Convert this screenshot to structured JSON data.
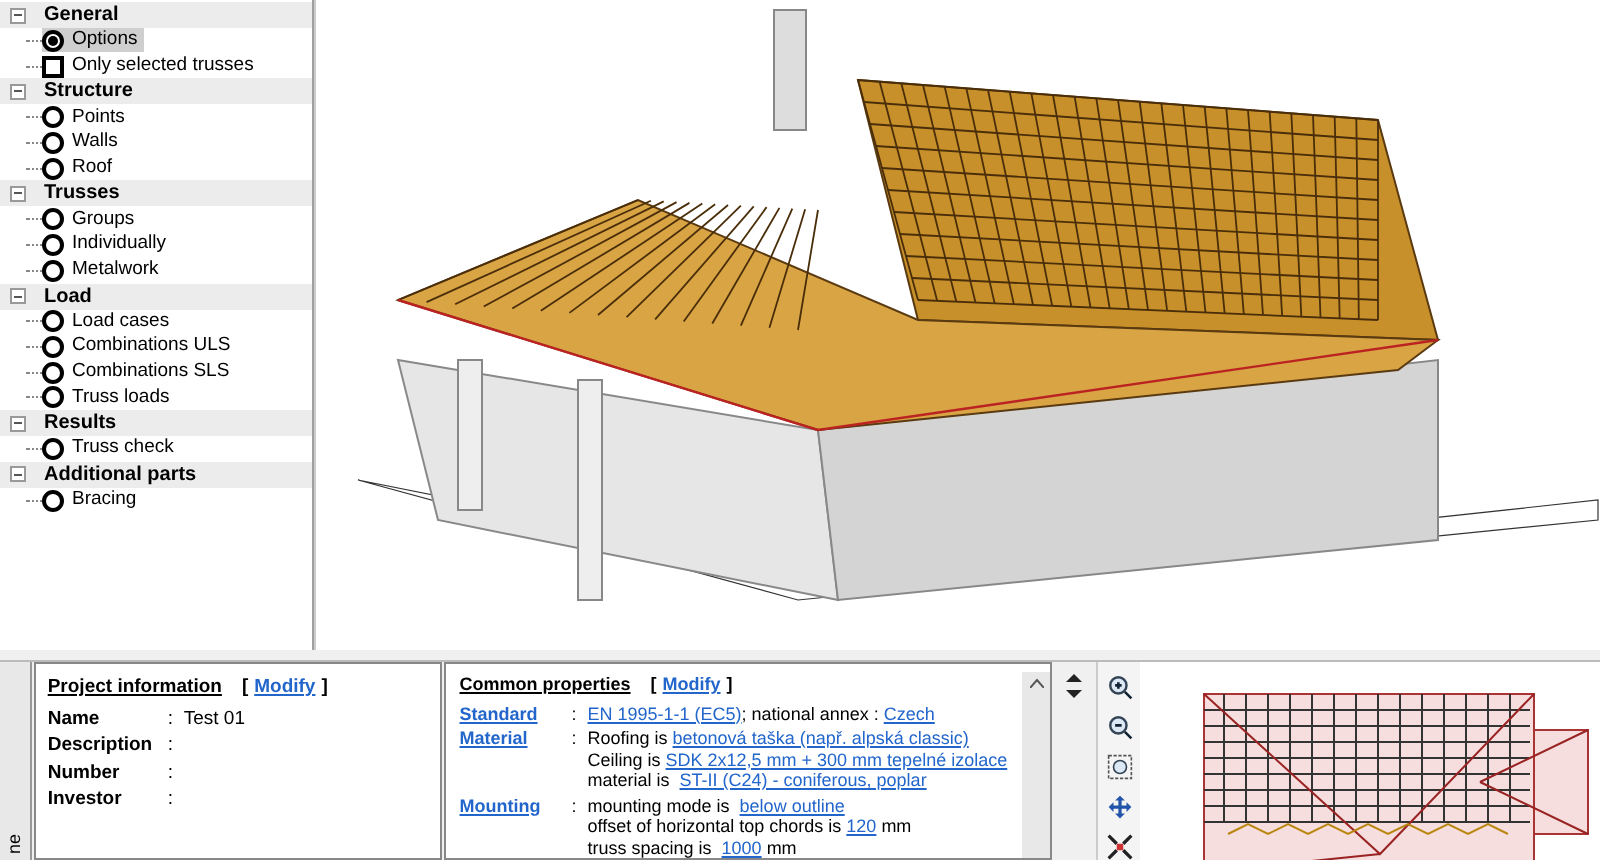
{
  "tree": [
    {
      "label": "General",
      "expanded": true,
      "items": [
        {
          "label": "Options",
          "kind": "radio",
          "selected": true
        },
        {
          "label": "Only selected trusses",
          "kind": "checkbox",
          "checked": false
        }
      ]
    },
    {
      "label": "Structure",
      "expanded": true,
      "items": [
        {
          "label": "Points",
          "kind": "radio",
          "selected": false
        },
        {
          "label": "Walls",
          "kind": "radio",
          "selected": false
        },
        {
          "label": "Roof",
          "kind": "radio",
          "selected": false
        }
      ]
    },
    {
      "label": "Trusses",
      "expanded": true,
      "items": [
        {
          "label": "Groups",
          "kind": "radio",
          "selected": false
        },
        {
          "label": "Individually",
          "kind": "radio",
          "selected": false
        },
        {
          "label": "Metalwork",
          "kind": "radio",
          "selected": false
        }
      ]
    },
    {
      "label": "Load",
      "expanded": true,
      "items": [
        {
          "label": "Load cases",
          "kind": "radio",
          "selected": false
        },
        {
          "label": "Combinations ULS",
          "kind": "radio",
          "selected": false
        },
        {
          "label": "Combinations SLS",
          "kind": "radio",
          "selected": false
        },
        {
          "label": "Truss loads",
          "kind": "radio",
          "selected": false
        }
      ]
    },
    {
      "label": "Results",
      "expanded": true,
      "items": [
        {
          "label": "Truss check",
          "kind": "radio",
          "selected": false
        }
      ]
    },
    {
      "label": "Additional parts",
      "expanded": true,
      "items": [
        {
          "label": "Bracing",
          "kind": "radio",
          "selected": false
        }
      ]
    }
  ],
  "side_tab": "ne",
  "project_info": {
    "title": "Project information",
    "bracket_open": "[",
    "action": "Modify",
    "bracket_close": "]",
    "fields": [
      {
        "label": "Name",
        "separator": ":",
        "value": "Test 01"
      },
      {
        "label": "Description",
        "separator": ":"
      },
      {
        "label": "Number",
        "separator": ":"
      },
      {
        "label": "Investor",
        "separator": ":"
      }
    ]
  },
  "common_properties": {
    "title": "Common properties",
    "bracket_open": "[",
    "action": "Modify",
    "bracket_close": "]",
    "groups": [
      {
        "label": "Standard",
        "separator": ":",
        "lines": [
          [
            {
              "text": "EN 1995-1-1 (EC5)",
              "link": true
            },
            {
              "text": "; national annex : ",
              "link": false
            },
            {
              "text": "Czech",
              "link": true
            }
          ]
        ]
      },
      {
        "label": "Material",
        "separator": ":",
        "lines": [
          [
            {
              "text": "Roofing is ",
              "link": false
            },
            {
              "text": "betonová taška (např. alpská classic)",
              "link": true
            }
          ],
          [
            {
              "text": "Ceiling is ",
              "link": false
            },
            {
              "text": "SDK 2x12,5 mm + 300 mm tepelné izolace",
              "link": true
            }
          ],
          [
            {
              "text": "material is  ",
              "link": false
            },
            {
              "text": "ST-II (C24) - coniferous, poplar",
              "link": true
            }
          ]
        ]
      },
      {
        "label": "Mounting",
        "separator": ":",
        "lines": [
          [
            {
              "text": "mounting mode is  ",
              "link": false
            },
            {
              "text": "below outline",
              "link": true
            }
          ],
          [
            {
              "text": "offset of horizontal top chords is ",
              "link": false
            },
            {
              "text": "120",
              "link": true
            },
            {
              "text": " mm",
              "link": false
            }
          ],
          [
            {
              "text": "truss spacing is  ",
              "link": false
            },
            {
              "text": "1000",
              "link": true
            },
            {
              "text": " mm",
              "link": false
            }
          ]
        ]
      }
    ]
  },
  "toolbar": [
    {
      "kind": "zoom-in"
    },
    {
      "kind": "zoom-out"
    },
    {
      "kind": "zoom-extent"
    },
    {
      "kind": "pan"
    },
    {
      "kind": "fit"
    }
  ]
}
